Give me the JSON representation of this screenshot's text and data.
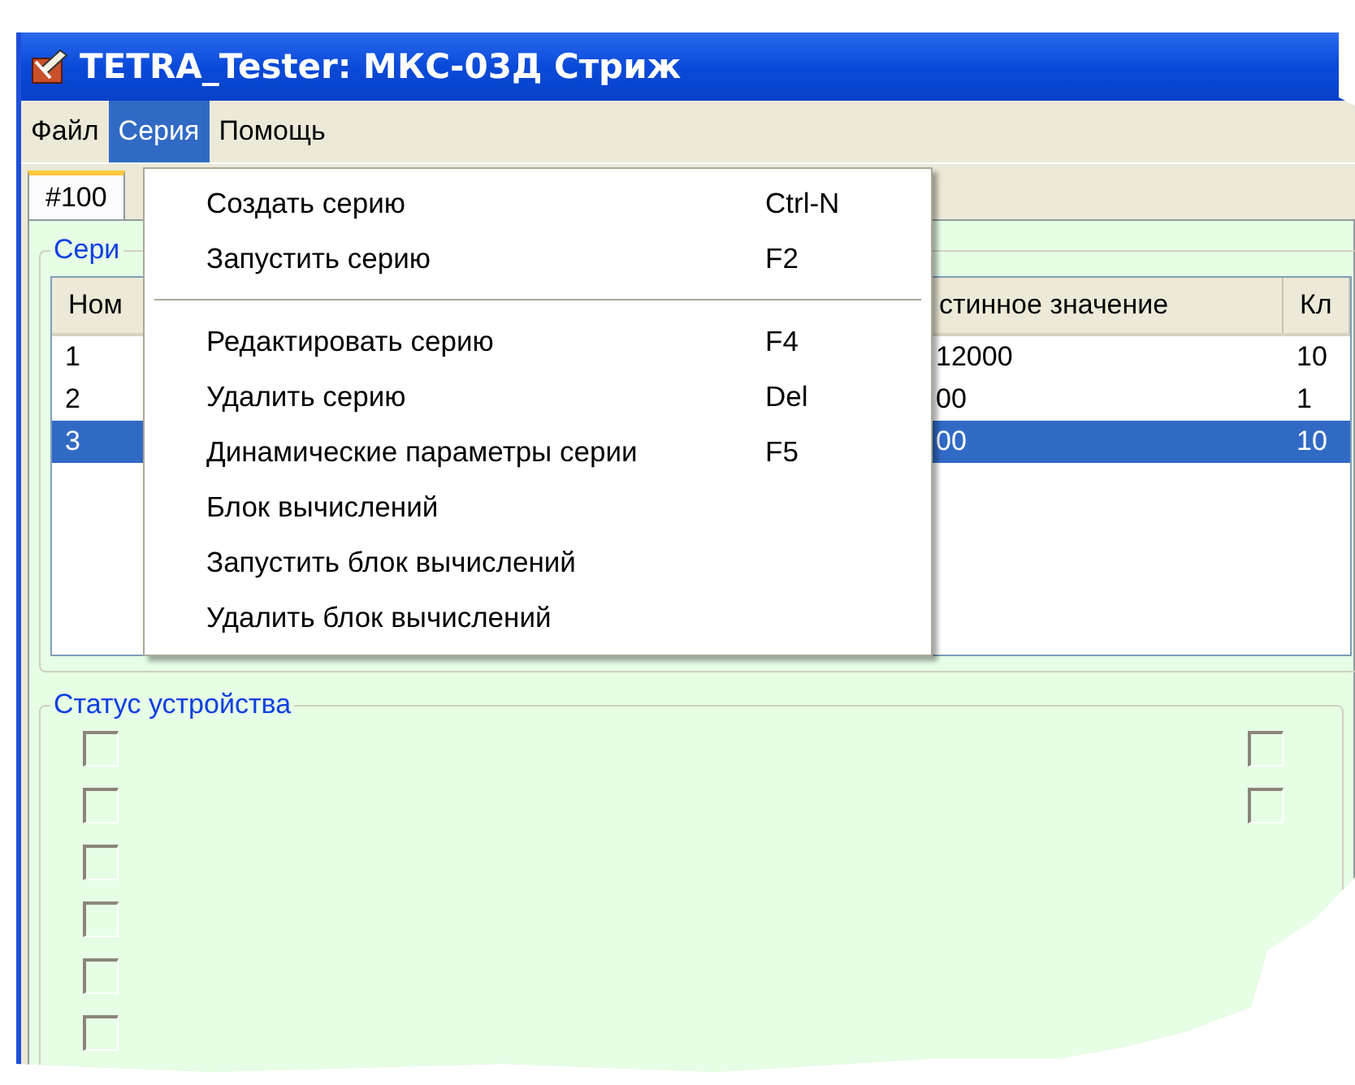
{
  "window": {
    "title": "TETRA_Tester: МКС-03Д Стриж"
  },
  "menu_bar": [
    {
      "label": "Файл",
      "selected": false
    },
    {
      "label": "Серия",
      "selected": true
    },
    {
      "label": "Помощь",
      "selected": false
    }
  ],
  "tabs": [
    {
      "label": "#100",
      "selected": true
    }
  ],
  "series_group": {
    "title": "Сери",
    "table": {
      "columns": [
        "Ном",
        "стинное значение",
        "Кл"
      ],
      "rows": [
        {
          "cells": [
            "1",
            "12000",
            "10"
          ],
          "selected": false
        },
        {
          "cells": [
            "2",
            "00",
            "1"
          ],
          "selected": false
        },
        {
          "cells": [
            "3",
            "00",
            "10"
          ],
          "selected": true
        }
      ]
    }
  },
  "status_group": {
    "title": "Статус устройства",
    "left_checkboxes": [
      {
        "checked": false
      },
      {
        "checked": false
      },
      {
        "checked": false
      },
      {
        "checked": false
      },
      {
        "checked": false
      },
      {
        "checked": false
      }
    ],
    "right_checkboxes": [
      {
        "checked": false
      },
      {
        "checked": false
      }
    ]
  },
  "dropdown_menu": [
    {
      "kind": "item",
      "label": "Создать серию",
      "shortcut": "Ctrl-N"
    },
    {
      "kind": "item",
      "label": "Запустить серию",
      "shortcut": "F2"
    },
    {
      "kind": "separator"
    },
    {
      "kind": "item",
      "label": "Редактировать серию",
      "shortcut": "F4"
    },
    {
      "kind": "item",
      "label": "Удалить серию",
      "shortcut": "Del"
    },
    {
      "kind": "item",
      "label": "Динамические параметры серии",
      "shortcut": "F5"
    },
    {
      "kind": "item",
      "label": "Блок вычислений"
    },
    {
      "kind": "item",
      "label": "Запустить блок вычислений"
    },
    {
      "kind": "item",
      "label": "Удалить блок вычислений"
    }
  ]
}
